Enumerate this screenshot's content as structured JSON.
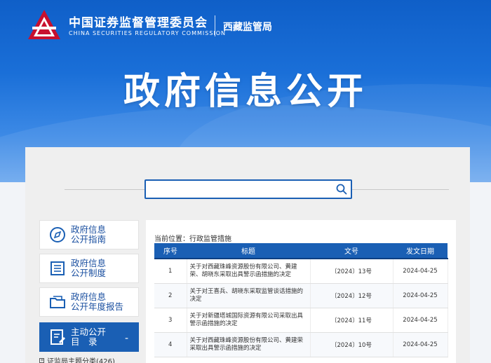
{
  "header": {
    "org_cn": "中国证券监督管理委员会",
    "org_en": "CHINA SECURITIES REGULATORY COMMISSION",
    "branch": "西藏监管局",
    "page_title": "政府信息公开",
    "brand_color": "#c8102e",
    "accent_color": "#1a5fb4"
  },
  "search": {
    "value": "",
    "placeholder": ""
  },
  "sidebar": {
    "items": [
      {
        "icon": "compass-icon",
        "line1": "政府信息",
        "line2": "公开指南"
      },
      {
        "icon": "list-icon",
        "line1": "政府信息",
        "line2": "公开制度"
      },
      {
        "icon": "folder-icon",
        "line1": "政府信息",
        "line2": "公开年度报告"
      },
      {
        "icon": "document-edit-icon",
        "line1": "主动公开",
        "line2": "目　录",
        "toggle": "-"
      }
    ],
    "sub_item": "证监局主题分类(426)"
  },
  "main": {
    "breadcrumb": "当前位置：行政监管措施",
    "columns": [
      "序号",
      "标题",
      "文号",
      "发文日期"
    ],
    "rows": [
      {
        "no": "1",
        "title": "关于对西藏珠峰资源股份有限公司、黄建荣、胡晓东采取出具警示函措施的决定",
        "doc_no": "〔2024〕13号",
        "date": "2024-04-25"
      },
      {
        "no": "2",
        "title": "关于对王喜兵、胡晓东采取监管谈话措施的决定",
        "doc_no": "〔2024〕12号",
        "date": "2024-04-25"
      },
      {
        "no": "3",
        "title": "关于对新疆塔城国际资源有限公司采取出具警示函措施的决定",
        "doc_no": "〔2024〕11号",
        "date": "2024-04-25"
      },
      {
        "no": "4",
        "title": "关于对西藏珠峰资源股份有限公司、黄建荣采取出具警示函措施的决定",
        "doc_no": "〔2024〕10号",
        "date": "2024-04-25"
      }
    ]
  }
}
